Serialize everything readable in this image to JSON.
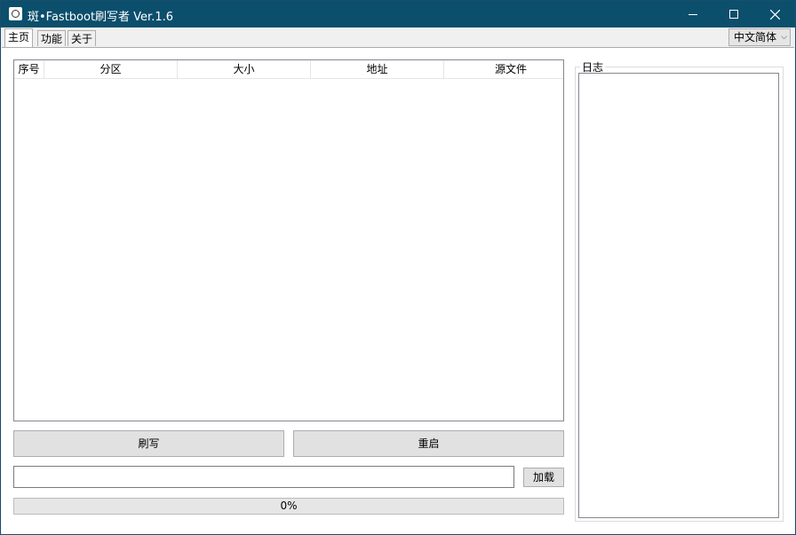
{
  "window": {
    "title": "斑•Fastboot刷写者 Ver.1.6",
    "controls": {
      "minimize": "minimize-icon",
      "maximize": "maximize-icon",
      "close": "close-icon"
    }
  },
  "tabs": [
    {
      "label": "主页",
      "active": true
    },
    {
      "label": "功能",
      "active": false
    },
    {
      "label": "关于",
      "active": false
    }
  ],
  "language_select": {
    "selected": "中文简体"
  },
  "partition_table": {
    "columns": [
      "序号",
      "分区",
      "大小",
      "地址",
      "源文件"
    ],
    "rows": []
  },
  "actions": {
    "flash_label": "刷写",
    "reboot_label": "重启"
  },
  "file_input": {
    "value": "",
    "load_label": "加载"
  },
  "progress": {
    "percent": 0,
    "text": "0%"
  },
  "log": {
    "title": "日志",
    "content": ""
  },
  "colors": {
    "titlebar": "#0b4f6c",
    "progress_fill": "#06b025"
  }
}
